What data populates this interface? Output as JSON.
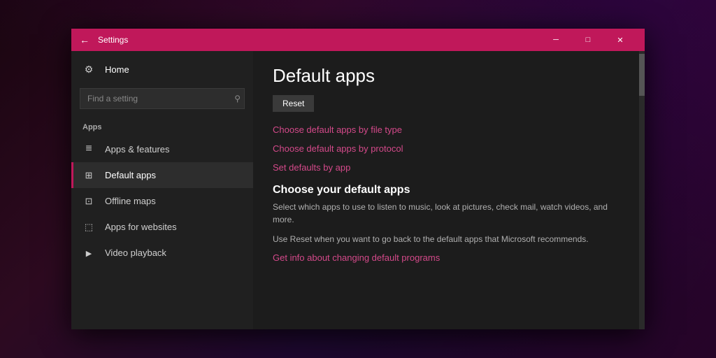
{
  "titlebar": {
    "title": "Settings",
    "back_label": "←",
    "minimize_label": "─",
    "maximize_label": "□",
    "close_label": "✕"
  },
  "sidebar": {
    "home_label": "Home",
    "search_placeholder": "Find a setting",
    "section_label": "Apps",
    "items": [
      {
        "id": "apps-features",
        "label": "Apps & features",
        "icon": "apps-features-icon",
        "active": false
      },
      {
        "id": "default-apps",
        "label": "Default apps",
        "icon": "default-apps-icon",
        "active": true
      },
      {
        "id": "offline-maps",
        "label": "Offline maps",
        "icon": "offline-maps-icon",
        "active": false
      },
      {
        "id": "apps-for-websites",
        "label": "Apps for websites",
        "icon": "apps-websites-icon",
        "active": false
      },
      {
        "id": "video-playback",
        "label": "Video playback",
        "icon": "video-playback-icon",
        "active": false
      }
    ]
  },
  "content": {
    "title": "Default apps",
    "reset_button": "Reset",
    "links": [
      {
        "id": "by-file-type",
        "text": "Choose default apps by file type"
      },
      {
        "id": "by-protocol",
        "text": "Choose default apps by protocol"
      },
      {
        "id": "set-defaults",
        "text": "Set defaults by app"
      }
    ],
    "section_title": "Choose your default apps",
    "section_desc_1": "Select which apps to use to listen to music, look at pictures, check mail, watch videos, and more.",
    "section_desc_2": "Use Reset when you want to go back to the default apps that Microsoft recommends.",
    "info_link": "Get info about changing default programs"
  }
}
